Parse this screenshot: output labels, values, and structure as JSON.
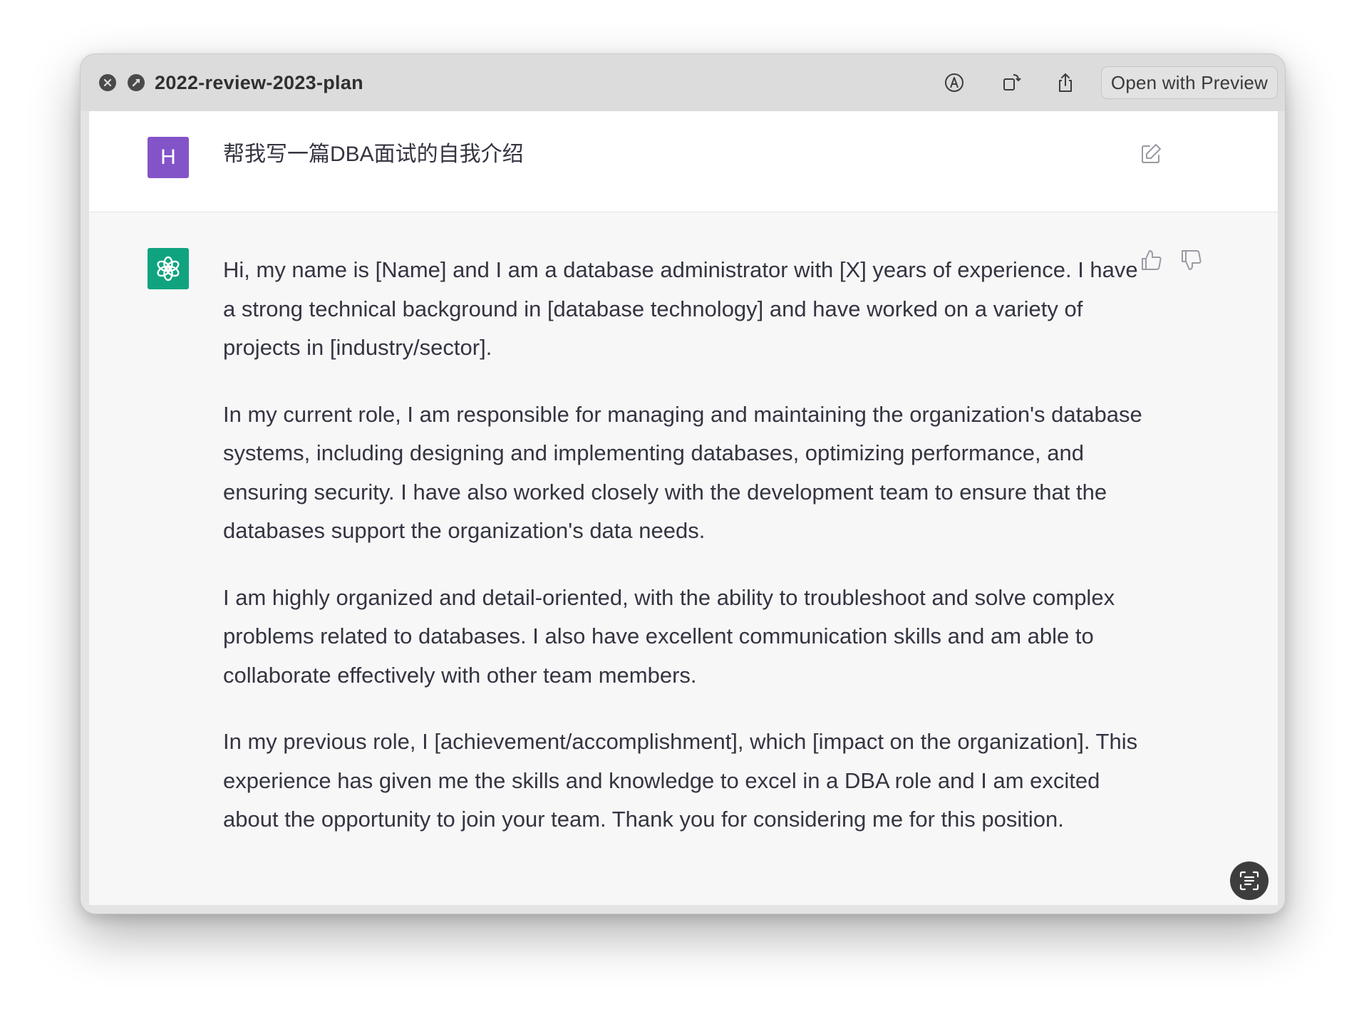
{
  "window": {
    "title": "2022-review-2023-plan",
    "open_with_label": "Open with Preview"
  },
  "conversation": {
    "user": {
      "avatar_letter": "H",
      "message": "帮我写一篇DBA面试的自我介绍"
    },
    "assistant": {
      "paragraphs": [
        "Hi, my name is [Name] and I am a database administrator with [X] years of experience. I have a strong technical background in [database technology] and have worked on a variety of projects in [industry/sector].",
        "In my current role, I am responsible for managing and maintaining the organization's database systems, including designing and implementing databases, optimizing performance, and ensuring security. I have also worked closely with the development team to ensure that the databases support the organization's data needs.",
        "I am highly organized and detail-oriented, with the ability to troubleshoot and solve complex problems related to databases. I also have excellent communication skills and am able to collaborate effectively with other team members.",
        "In my previous role, I [achievement/accomplishment], which [impact on the organization]. This experience has given me the skills and knowledge to excel in a DBA role and I am excited about the opportunity to join your team. Thank you for considering me for this position."
      ]
    }
  },
  "colors": {
    "user_avatar": "#8354c8",
    "assistant_avatar": "#10a37f",
    "text": "#343541",
    "assistant_bg": "#f7f7f8"
  },
  "icons": {
    "close": "close-icon",
    "edit_mode": "markup-icon",
    "rotate": "rotate-icon",
    "share": "share-icon",
    "edit": "edit-icon",
    "thumb_up": "thumbs-up-icon",
    "thumb_down": "thumbs-down-icon",
    "text_scan": "live-text-icon"
  }
}
